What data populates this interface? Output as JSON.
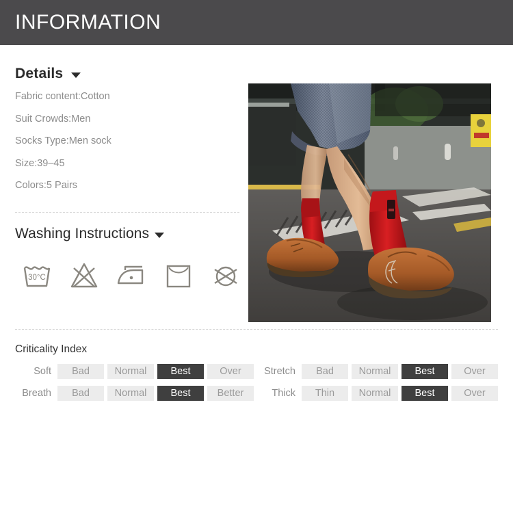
{
  "header": {
    "title": "INFORMATION"
  },
  "details": {
    "heading": "Details",
    "caret_icon": "chevron-down-icon",
    "specs": [
      "Fabric content:Cotton",
      "Suit Crowds:Men",
      "Socks Type:Men sock",
      "Size:39–45",
      "Colors:5 Pairs"
    ]
  },
  "washing": {
    "heading": "Washing Instructions",
    "caret_icon": "chevron-down-icon",
    "icons": [
      {
        "name": "wash-30c-icon",
        "label": "30°C"
      },
      {
        "name": "do-not-bleach-icon",
        "label": ""
      },
      {
        "name": "iron-low-heat-icon",
        "label": ""
      },
      {
        "name": "line-dry-icon",
        "label": ""
      },
      {
        "name": "do-not-dry-clean-icon",
        "label": ""
      }
    ]
  },
  "product_image": {
    "name": "product-photo",
    "alt": "Man wearing red socks with brown leather shoes on asphalt road"
  },
  "criticality": {
    "title": "Criticality Index",
    "rows": [
      {
        "label": "Soft",
        "options": [
          "Bad",
          "Normal",
          "Best",
          "Over"
        ],
        "selected": 2
      },
      {
        "label": "Stretch",
        "options": [
          "Bad",
          "Normal",
          "Best",
          "Over"
        ],
        "selected": 2
      },
      {
        "label": "Breath",
        "options": [
          "Bad",
          "Normal",
          "Best",
          "Better"
        ],
        "selected": 2
      },
      {
        "label": "Thick",
        "options": [
          "Thin",
          "Normal",
          "Best",
          "Over"
        ],
        "selected": 2
      }
    ]
  },
  "colors": {
    "header_bg": "#4b4a4c",
    "header_text": "#ffffff",
    "heading_text": "#2b2b2b",
    "body_text": "#8c8c8c",
    "cell_bg": "#ececec",
    "cell_active_bg": "#3f3f3f",
    "divider": "#d8d8d8",
    "icon_stroke": "#8a8780"
  }
}
